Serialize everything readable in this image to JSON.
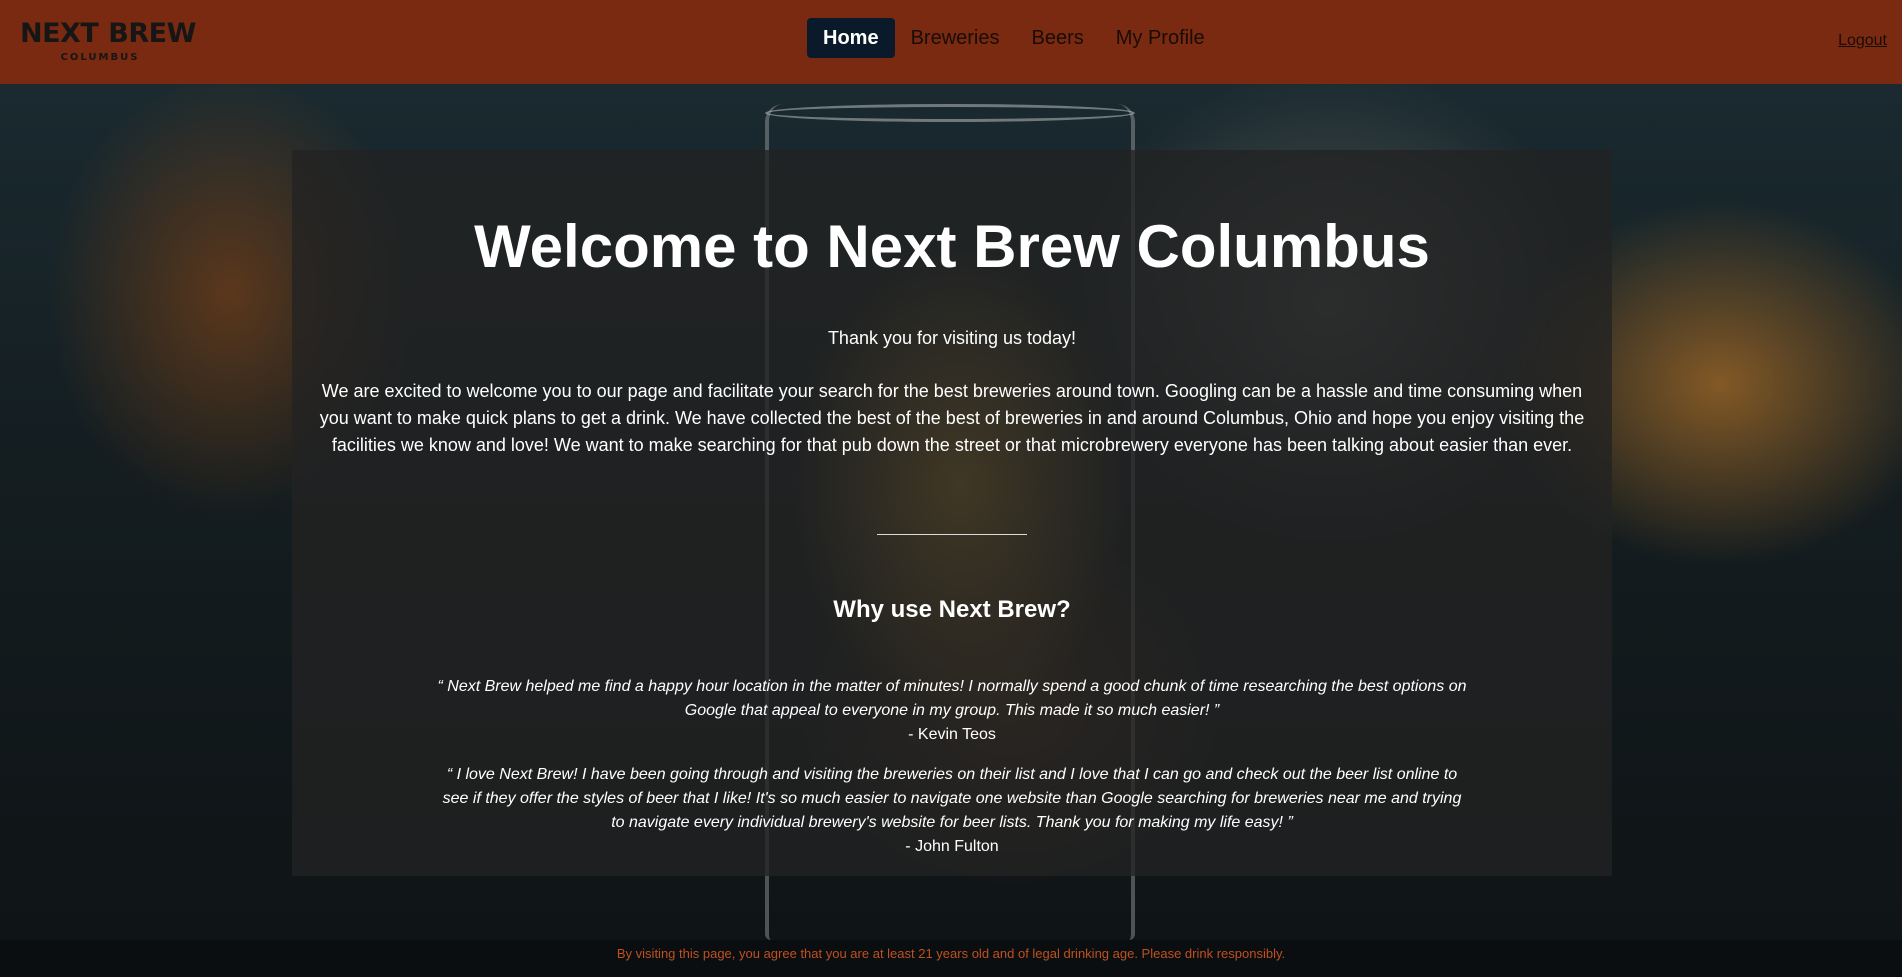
{
  "brand": {
    "name_left": "NEXT",
    "name_right": "BREW",
    "sub": "COLUMBUS",
    "icon": "beer-glass-icon"
  },
  "nav": {
    "items": [
      {
        "label": "Home",
        "active": true
      },
      {
        "label": "Breweries",
        "active": false
      },
      {
        "label": "Beers",
        "active": false
      },
      {
        "label": "My Profile",
        "active": false
      }
    ],
    "logout_label": "Logout"
  },
  "main": {
    "title": "Welcome to Next Brew Columbus",
    "thanks": "Thank you for visiting us today!",
    "intro": "We are excited to welcome you to our page and facilitate your search for the best breweries around town. Googling can be a hassle and time consuming when you want to make quick plans to get a drink. We have collected the best of the best of breweries in and around Columbus, Ohio and hope you enjoy visiting the facilities we know and love! We want to make searching for that pub down the street or that microbrewery everyone has been talking about easier than ever.",
    "why_heading": "Why use Next Brew?",
    "testimonials": [
      {
        "quote": "“ Next Brew helped me find a happy hour location in the matter of minutes! I normally spend a good chunk of time researching the best options on Google that appeal to everyone in my group. This made it so much easier! ”",
        "author": "- Kevin Teos"
      },
      {
        "quote": "“ I love Next Brew! I have been going through and visiting the breweries on their list and I love that I can go and check out the beer list online to see if they offer the styles of beer that I like! It's so much easier to navigate one website than Google searching for breweries near me and trying to navigate every individual brewery's website for beer lists. Thank you for making my life easy! ”",
        "author": "- John Fulton"
      }
    ]
  },
  "footer": {
    "disclaimer": "By visiting this page, you agree that you are at least 21 years old and of legal drinking age. Please drink responsibly."
  },
  "colors": {
    "navbar_bg": "#7a2a10",
    "nav_active_bg": "#0b1a2b",
    "footer_text": "#c0501e"
  }
}
